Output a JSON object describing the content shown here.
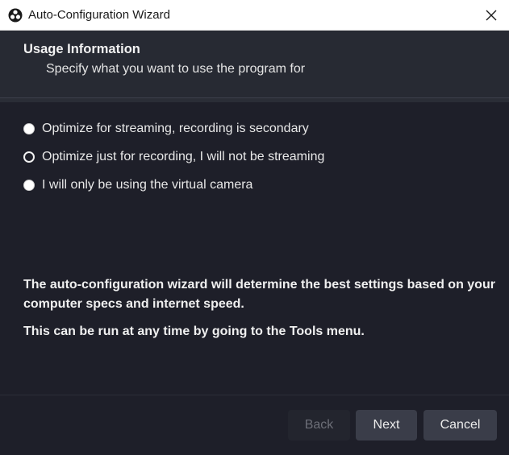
{
  "window": {
    "title": "Auto-Configuration Wizard",
    "app_icon": "obs-logo-icon",
    "close_icon": "close-icon"
  },
  "header": {
    "title": "Usage Information",
    "subtitle": "Specify what you want to use the program for"
  },
  "options": [
    {
      "label": "Optimize for streaming, recording is secondary",
      "selected": false
    },
    {
      "label": "Optimize just for recording, I will not be streaming",
      "selected": true
    },
    {
      "label": "I will only be using the virtual camera",
      "selected": false
    }
  ],
  "info": {
    "line1": "The auto-configuration wizard will determine the best settings based on your computer specs and internet speed.",
    "line2": "This can be run at any time by going to the Tools menu."
  },
  "buttons": {
    "back": "Back",
    "next": "Next",
    "cancel": "Cancel",
    "back_disabled": true
  },
  "colors": {
    "background": "#1e1f29",
    "header_background": "#272a33",
    "button_background": "#3a3d49"
  }
}
